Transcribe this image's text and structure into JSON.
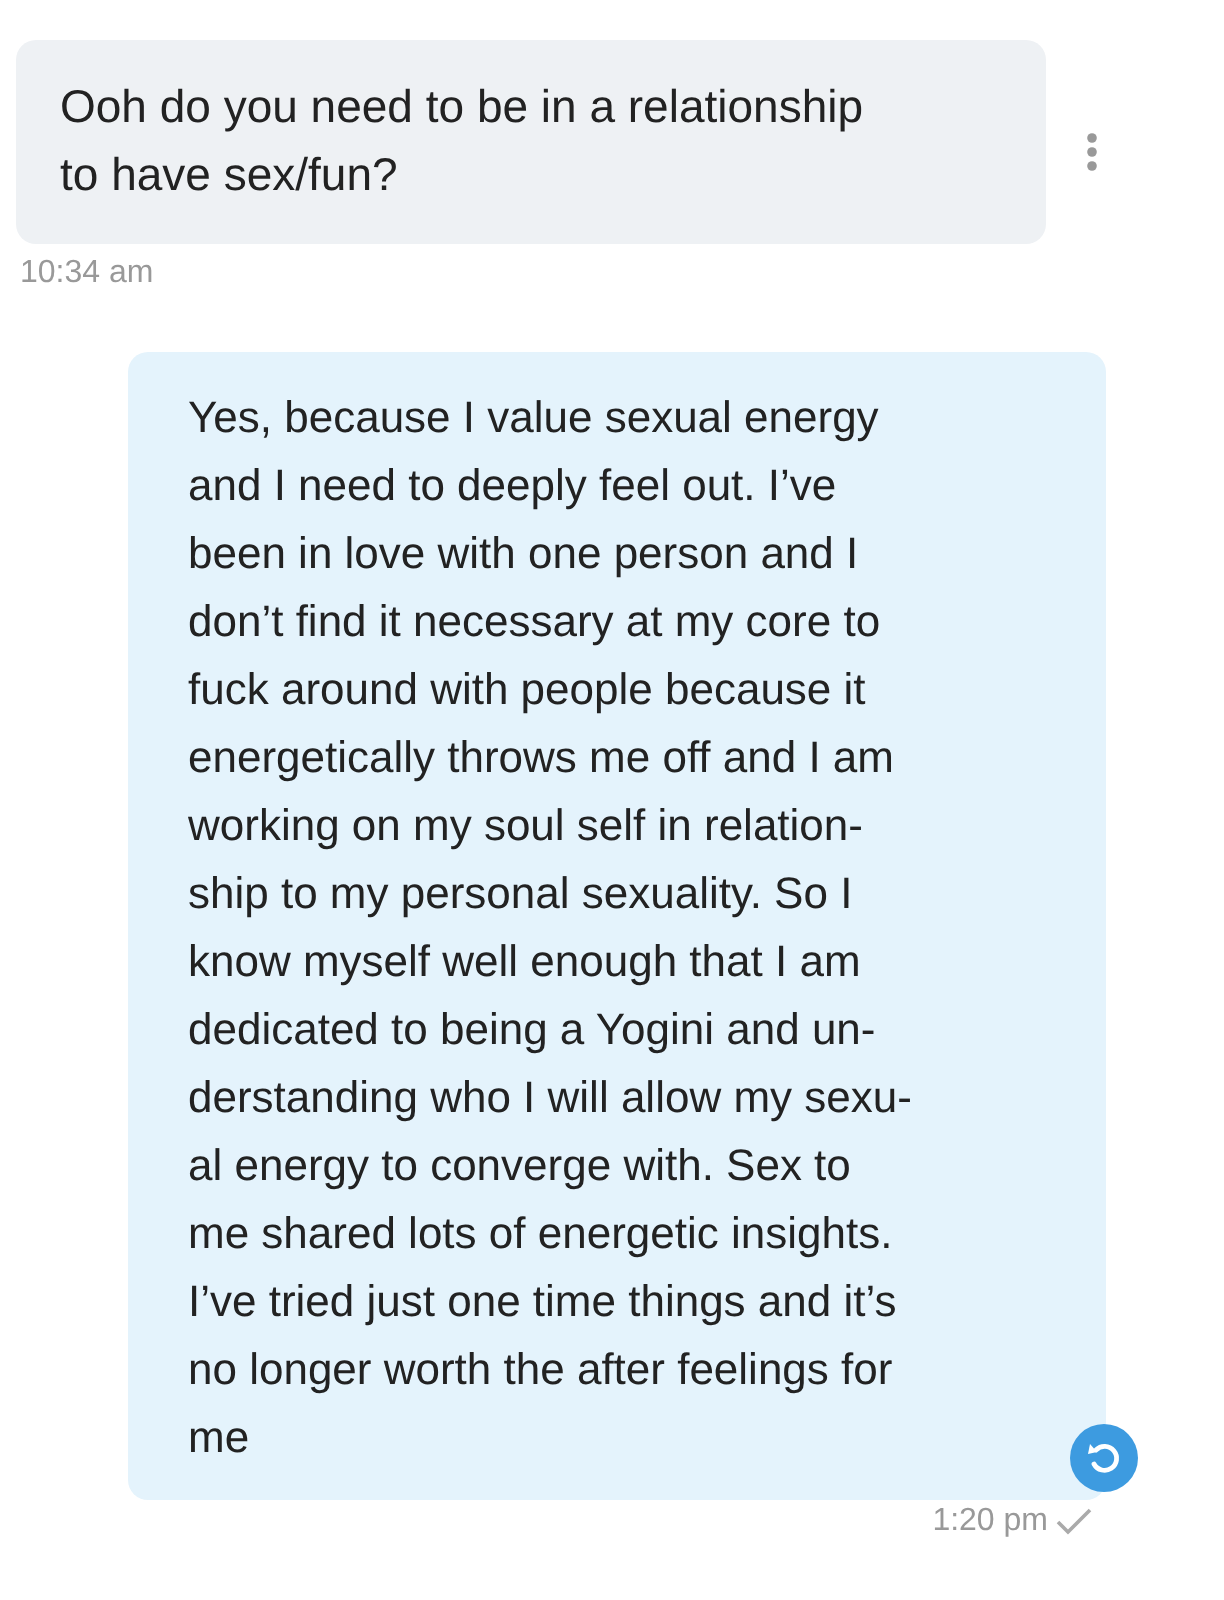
{
  "messages": [
    {
      "kind": "incoming",
      "text": "Ooh do you need to be in a relationship\nto have sex/fun?",
      "time": "10:34 am"
    },
    {
      "kind": "outgoing",
      "text": "Yes, because I value sexual energy\nand I need to deeply feel out. I’ve\nbeen in love with one person and I\ndon’t find it necessary at my core to\nfuck around with people because it\nenergetically throws me off and I am\nworking on my soul self in relation-\nship to my personal sexuality. So I\nknow myself well enough that I am\ndedicated to being a Yogini and un-\nderstanding who I will allow my sexu-\nal energy to converge with. Sex to\nme shared lots of energetic insights.\nI’ve tried just one time things and it’s\nno longer worth the after feelings for\nme",
      "time": "1:20 pm"
    }
  ]
}
